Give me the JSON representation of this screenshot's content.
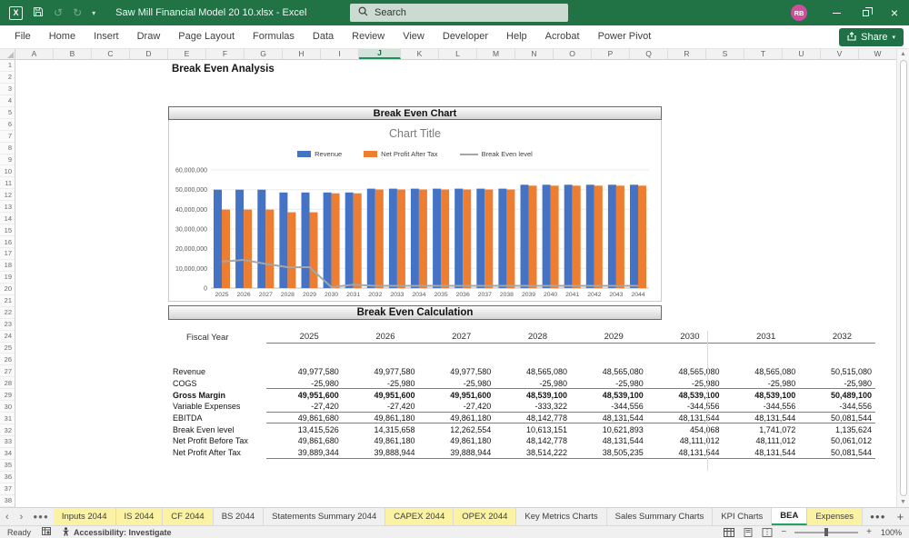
{
  "title_bar": {
    "app_title": "Saw Mill Financial Model 20 10.xlsx - Excel",
    "search_placeholder": "Search",
    "avatar_initials": "RB"
  },
  "ribbon": {
    "tabs": [
      "File",
      "Home",
      "Insert",
      "Draw",
      "Page Layout",
      "Formulas",
      "Data",
      "Review",
      "View",
      "Developer",
      "Help",
      "Acrobat",
      "Power Pivot"
    ],
    "share_label": "Share"
  },
  "grid": {
    "column_letters": [
      "A",
      "B",
      "C",
      "D",
      "E",
      "F",
      "G",
      "H",
      "I",
      "J",
      "K",
      "L",
      "M",
      "N",
      "O",
      "P",
      "Q",
      "R",
      "S",
      "T",
      "U",
      "V",
      "W"
    ],
    "selected_column": "J",
    "row_count": 38
  },
  "sheet": {
    "page_title": "Break Even Analysis",
    "chart_banner": "Break Even Chart",
    "calc_banner": "Break Even Calculation",
    "table": {
      "fiscal_year_label": "Fiscal Year",
      "years": [
        "2025",
        "2026",
        "2027",
        "2028",
        "2029",
        "2030",
        "2031",
        "2032"
      ],
      "rows": [
        {
          "label": "Revenue",
          "bold": false,
          "rule_after": false,
          "values": [
            "49,977,580",
            "49,977,580",
            "49,977,580",
            "48,565,080",
            "48,565,080",
            "48,565,080",
            "48,565,080",
            "50,515,080"
          ]
        },
        {
          "label": "COGS",
          "bold": false,
          "rule_after": true,
          "values": [
            "-25,980",
            "-25,980",
            "-25,980",
            "-25,980",
            "-25,980",
            "-25,980",
            "-25,980",
            "-25,980"
          ]
        },
        {
          "label": "Gross Margin",
          "bold": true,
          "rule_after": false,
          "values": [
            "49,951,600",
            "49,951,600",
            "49,951,600",
            "48,539,100",
            "48,539,100",
            "48,539,100",
            "48,539,100",
            "50,489,100"
          ]
        },
        {
          "label": "Variable Expenses",
          "bold": false,
          "rule_after": true,
          "values": [
            "-27,420",
            "-27,420",
            "-27,420",
            "-333,322",
            "-344,556",
            "-344,556",
            "-344,556",
            "-344,556"
          ]
        },
        {
          "label": "EBITDA",
          "bold": false,
          "rule_after": true,
          "values": [
            "49,861,680",
            "49,861,180",
            "49,861,180",
            "48,142,778",
            "48,131,544",
            "48,131,544",
            "48,131,544",
            "50,081,544"
          ]
        },
        {
          "label": "Break Even level",
          "bold": false,
          "rule_after": false,
          "values": [
            "13,415,526",
            "14,315,658",
            "12,262,554",
            "10,613,151",
            "10,621,893",
            "454,068",
            "1,741,072",
            "1,135,624"
          ]
        },
        {
          "label": "Net Profit Before Tax",
          "bold": false,
          "rule_after": false,
          "values": [
            "49,861,680",
            "49,861,180",
            "49,861,180",
            "48,142,778",
            "48,131,544",
            "48,111,012",
            "48,111,012",
            "50,061,012"
          ]
        },
        {
          "label": "Net Profit After Tax",
          "bold": false,
          "rule_after": true,
          "values": [
            "39,889,344",
            "39,888,944",
            "39,888,944",
            "38,514,222",
            "38,505,235",
            "48,131,544",
            "48,131,544",
            "50,081,544"
          ]
        }
      ]
    }
  },
  "chart_data": {
    "type": "bar",
    "title": "Chart Title",
    "categories": [
      "2025",
      "2026",
      "2027",
      "2028",
      "2029",
      "2030",
      "2031",
      "2032",
      "2033",
      "2034",
      "2035",
      "2036",
      "2037",
      "2038",
      "2039",
      "2040",
      "2041",
      "2042",
      "2043",
      "2044"
    ],
    "series": [
      {
        "name": "Revenue",
        "kind": "bar",
        "color": "#4472C4",
        "values": [
          49977580,
          49977580,
          49977580,
          48565080,
          48565080,
          48565080,
          48565080,
          50515080,
          50515080,
          50515080,
          50515080,
          50515080,
          50515080,
          50515080,
          52465080,
          52465080,
          52465080,
          52465080,
          52465080,
          52465080
        ]
      },
      {
        "name": "Net Profit After Tax",
        "kind": "bar",
        "color": "#ED7D31",
        "values": [
          39889344,
          39888944,
          39888944,
          38514222,
          38505235,
          48131544,
          48131544,
          50081544,
          50081544,
          50081544,
          50081544,
          50081544,
          50081544,
          50081544,
          52031544,
          52031544,
          52031544,
          52031544,
          52031544,
          52031544
        ]
      },
      {
        "name": "Break Even level",
        "kind": "line",
        "color": "#A6A6A6",
        "values": [
          13415526,
          14315658,
          12262554,
          10613151,
          10621893,
          454068,
          1741072,
          1135624,
          1135624,
          1135624,
          1135624,
          1135624,
          1135624,
          1135624,
          1135624,
          1135624,
          1135624,
          1135624,
          1135624,
          1135624
        ]
      }
    ],
    "ylim": [
      0,
      60000000
    ],
    "ytick_step": 10000000,
    "ytick_labels": [
      "0",
      "10,000,000",
      "20,000,000",
      "30,000,000",
      "40,000,000",
      "50,000,000",
      "60,000,000"
    ],
    "legend_position": "top",
    "grid": true
  },
  "sheet_tabs": {
    "highlight_color": "#FBF3A3",
    "tabs": [
      {
        "label": "Inputs 2044",
        "highlight": true,
        "active": false
      },
      {
        "label": "IS 2044",
        "highlight": true,
        "active": false
      },
      {
        "label": "CF 2044",
        "highlight": true,
        "active": false
      },
      {
        "label": "BS 2044",
        "highlight": false,
        "active": false
      },
      {
        "label": "Statements Summary 2044",
        "highlight": false,
        "active": false
      },
      {
        "label": "CAPEX 2044",
        "highlight": true,
        "active": false
      },
      {
        "label": "OPEX 2044",
        "highlight": true,
        "active": false
      },
      {
        "label": "Key Metrics Charts",
        "highlight": false,
        "active": false
      },
      {
        "label": "Sales Summary Charts",
        "highlight": false,
        "active": false
      },
      {
        "label": "KPI Charts",
        "highlight": false,
        "active": false
      },
      {
        "label": "BEA",
        "highlight": false,
        "active": true
      },
      {
        "label": "Expenses",
        "highlight": true,
        "active": false
      }
    ]
  },
  "status_bar": {
    "ready_label": "Ready",
    "accessibility_label": "Accessibility: Investigate",
    "zoom_level": "100%"
  }
}
